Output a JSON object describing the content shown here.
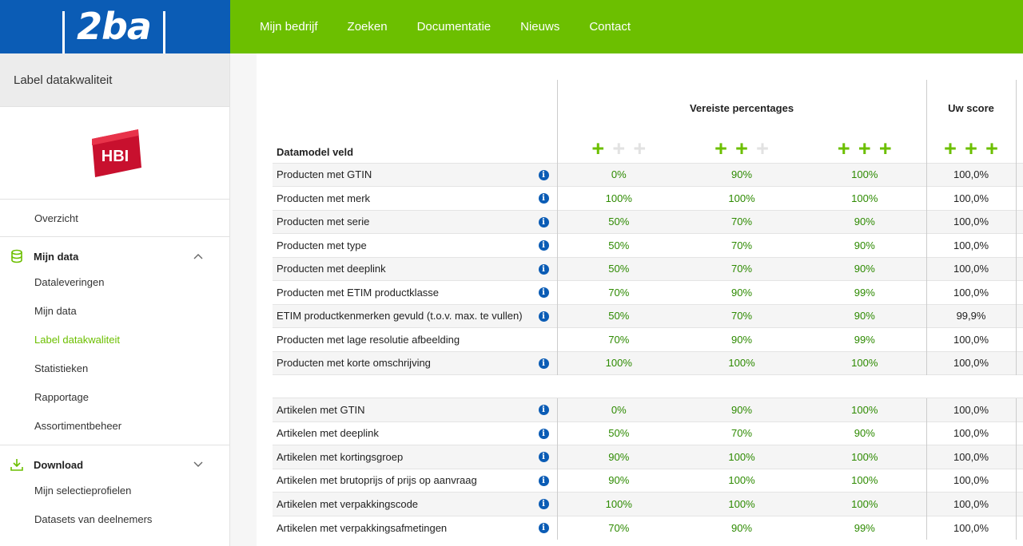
{
  "header": {
    "logo_text": "2ba",
    "nav": [
      "Mijn bedrijf",
      "Zoeken",
      "Documentatie",
      "Nieuws",
      "Contact"
    ]
  },
  "sidebar": {
    "title": "Label datakwaliteit",
    "brand_logo_text": "HBI",
    "overview": "Overzicht",
    "mijn_data_section": "Mijn data",
    "mijn_data_items": [
      "Dataleveringen",
      "Mijn data",
      "Label datakwaliteit",
      "Statistieken",
      "Rapportage",
      "Assortimentbeheer"
    ],
    "download_section": "Download",
    "download_items": [
      "Mijn selectieprofielen",
      "Datasets van deelnemers"
    ],
    "active_item": "Label datakwaliteit"
  },
  "table": {
    "header_required": "Vereiste percentages",
    "header_score": "Uw score",
    "header_field": "Datamodel veld",
    "levels": [
      1,
      2,
      3,
      3
    ],
    "products": [
      {
        "name": "Producten met GTIN",
        "info": true,
        "req": [
          "0%",
          "90%",
          "100%"
        ],
        "score": "100,0%"
      },
      {
        "name": "Producten met merk",
        "info": true,
        "req": [
          "100%",
          "100%",
          "100%"
        ],
        "score": "100,0%"
      },
      {
        "name": "Producten met serie",
        "info": true,
        "req": [
          "50%",
          "70%",
          "90%"
        ],
        "score": "100,0%"
      },
      {
        "name": "Producten met type",
        "info": true,
        "req": [
          "50%",
          "70%",
          "90%"
        ],
        "score": "100,0%"
      },
      {
        "name": "Producten met deeplink",
        "info": true,
        "req": [
          "50%",
          "70%",
          "90%"
        ],
        "score": "100,0%"
      },
      {
        "name": "Producten met ETIM productklasse",
        "info": true,
        "req": [
          "70%",
          "90%",
          "99%"
        ],
        "score": "100,0%"
      },
      {
        "name": "ETIM productkenmerken gevuld (t.o.v. max. te vullen)",
        "info": true,
        "req": [
          "50%",
          "70%",
          "90%"
        ],
        "score": "99,9%"
      },
      {
        "name": "Producten met lage resolutie afbeelding",
        "info": false,
        "req": [
          "70%",
          "90%",
          "99%"
        ],
        "score": "100,0%"
      },
      {
        "name": "Producten met korte omschrijving",
        "info": true,
        "req": [
          "100%",
          "100%",
          "100%"
        ],
        "score": "100,0%"
      }
    ],
    "articles": [
      {
        "name": "Artikelen met GTIN",
        "info": true,
        "req": [
          "0%",
          "90%",
          "100%"
        ],
        "score": "100,0%"
      },
      {
        "name": "Artikelen met deeplink",
        "info": true,
        "req": [
          "50%",
          "70%",
          "90%"
        ],
        "score": "100,0%"
      },
      {
        "name": "Artikelen met kortingsgroep",
        "info": true,
        "req": [
          "90%",
          "100%",
          "100%"
        ],
        "score": "100,0%"
      },
      {
        "name": "Artikelen met brutoprijs of prijs op aanvraag",
        "info": true,
        "req": [
          "90%",
          "100%",
          "100%"
        ],
        "score": "100,0%"
      },
      {
        "name": "Artikelen met verpakkingscode",
        "info": true,
        "req": [
          "100%",
          "100%",
          "100%"
        ],
        "score": "100,0%"
      },
      {
        "name": "Artikelen met verpakkingsafmetingen",
        "info": true,
        "req": [
          "70%",
          "90%",
          "99%"
        ],
        "score": "100,0%"
      }
    ]
  },
  "colors": {
    "brand_blue": "#0b5cb5",
    "brand_green": "#6cbf00",
    "req_text": "#2d8a00"
  }
}
